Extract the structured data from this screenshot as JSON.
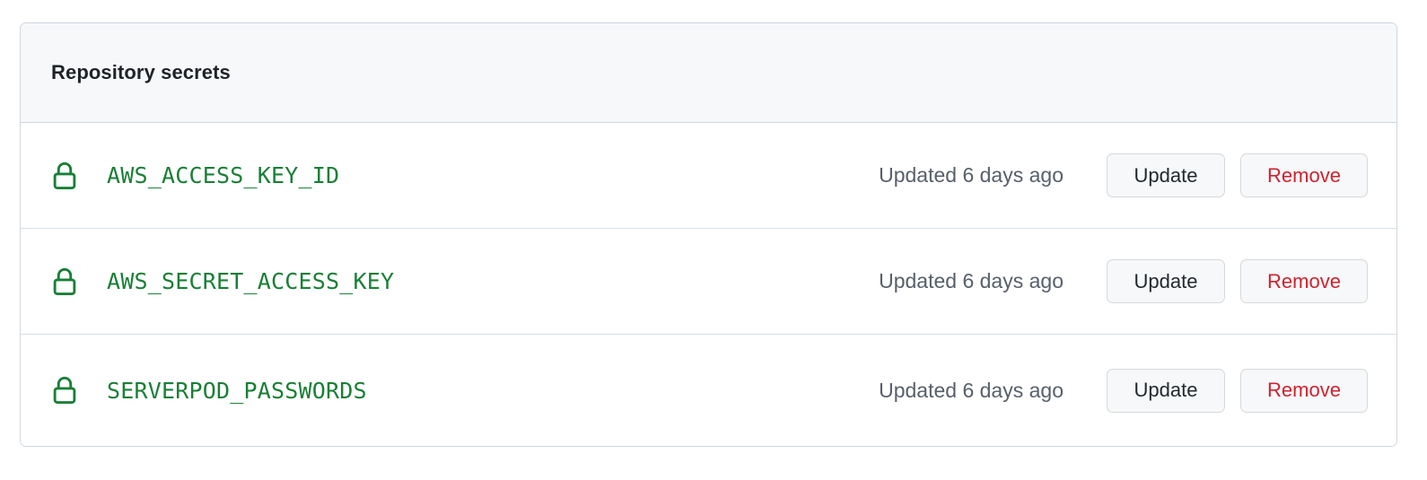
{
  "card": {
    "title": "Repository secrets",
    "icon": "lock-icon",
    "colors": {
      "header_bg": "#f6f8fa",
      "border": "#d0d7de",
      "row_divider": "#d8dee4",
      "secret_name": "#1a7f37",
      "lock": "#1a7f37",
      "muted_text": "#57606a",
      "title_text": "#1f2328",
      "button_bg": "#f6f8fa",
      "button_text": "#24292f",
      "danger_text": "#cf222e"
    },
    "rows": [
      {
        "name": "AWS_ACCESS_KEY_ID",
        "updated": "Updated 6 days ago",
        "update_label": "Update",
        "remove_label": "Remove"
      },
      {
        "name": "AWS_SECRET_ACCESS_KEY",
        "updated": "Updated 6 days ago",
        "update_label": "Update",
        "remove_label": "Remove"
      },
      {
        "name": "SERVERPOD_PASSWORDS",
        "updated": "Updated 6 days ago",
        "update_label": "Update",
        "remove_label": "Remove"
      }
    ]
  }
}
